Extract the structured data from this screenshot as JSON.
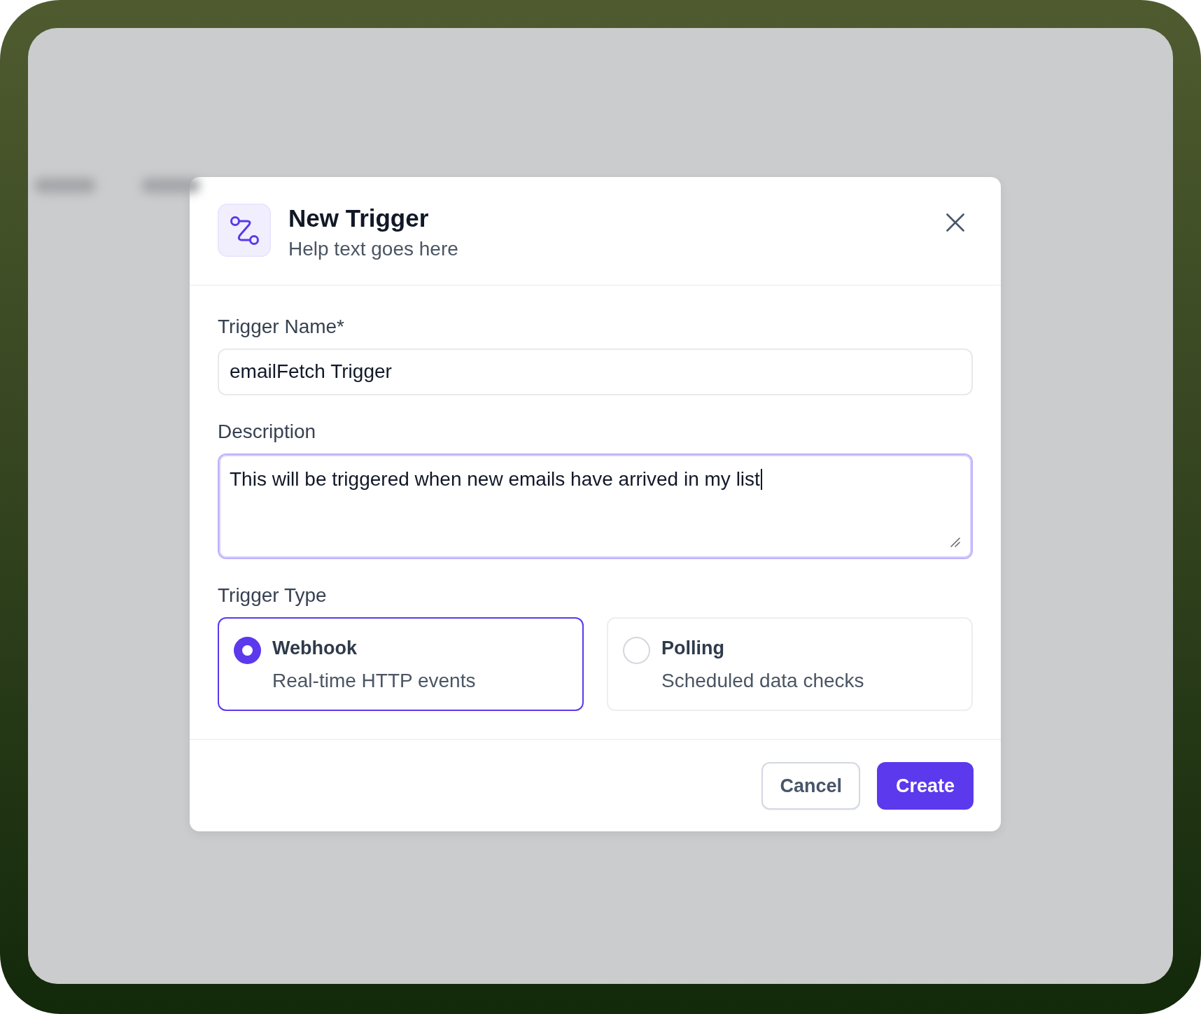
{
  "dialog": {
    "title": "New Trigger",
    "subtitle": "Help text goes here"
  },
  "fields": [
    {
      "kind": "input",
      "label": "Trigger Name*",
      "value": "emailFetch Trigger",
      "focused": false
    },
    {
      "kind": "textarea",
      "label": "Description",
      "value": "This will be triggered when new emails have arrived in my list",
      "focused": true
    }
  ],
  "trigger_type": {
    "label": "Trigger Type",
    "options": [
      {
        "title": "Webhook",
        "description": "Real-time HTTP events",
        "selected": true
      },
      {
        "title": "Polling",
        "description": "Scheduled data checks",
        "selected": false
      }
    ]
  },
  "buttons": [
    {
      "kind": "secondary",
      "label": "Cancel"
    },
    {
      "kind": "primary",
      "label": "Create"
    }
  ]
}
